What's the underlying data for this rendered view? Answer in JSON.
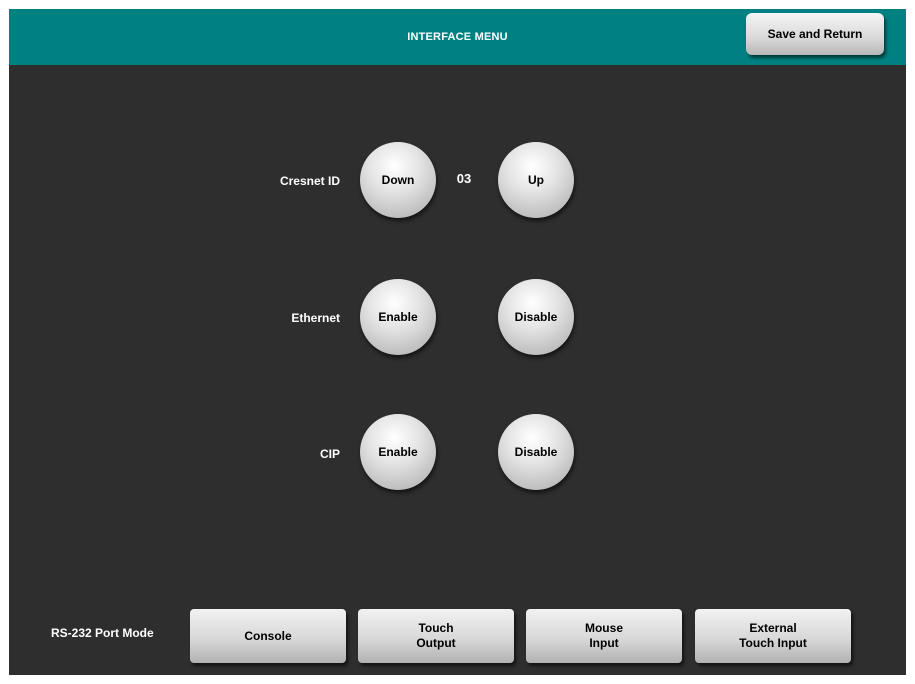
{
  "header": {
    "title": "INTERFACE MENU",
    "save_label": "Save and Return"
  },
  "cresnet": {
    "label": "Cresnet ID",
    "down_label": "Down",
    "value": "03",
    "up_label": "Up"
  },
  "ethernet": {
    "label": "Ethernet",
    "enable_label": "Enable",
    "disable_label": "Disable"
  },
  "cip": {
    "label": "CIP",
    "enable_label": "Enable",
    "disable_label": "Disable"
  },
  "rs232": {
    "label": "RS-232 Port Mode",
    "console_label": "Console",
    "touch_output": [
      "Touch",
      "Output"
    ],
    "mouse_input": [
      "Mouse",
      "Input"
    ],
    "external_touch_input": [
      "External",
      "Touch Input"
    ]
  },
  "colors": {
    "header": "#008080",
    "background": "#2e2e2e",
    "text": "#ffffff"
  }
}
